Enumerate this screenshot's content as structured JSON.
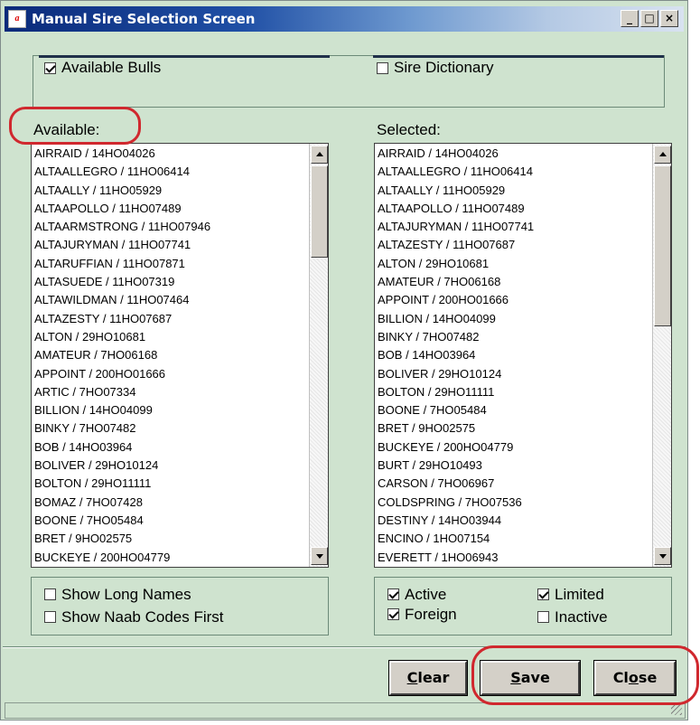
{
  "window": {
    "title": "Manual Sire Selection Screen",
    "min_glyph": "_",
    "max_glyph": "□",
    "close_glyph": "×"
  },
  "source_options": [
    {
      "label": "Available Bulls",
      "checked": true
    },
    {
      "label": "Sire Dictionary",
      "checked": false
    }
  ],
  "available": {
    "heading": "Available:",
    "items": [
      "AIRRAID / 14HO04026",
      "ALTAALLEGRO / 11HO06414",
      "ALTAALLY / 11HO05929",
      "ALTAAPOLLO / 11HO07489",
      "ALTAARMSTRONG / 11HO07946",
      "ALTAJURYMAN / 11HO07741",
      "ALTARUFFIAN / 11HO07871",
      "ALTASUEDE / 11HO07319",
      "ALTAWILDMAN / 11HO07464",
      "ALTAZESTY / 11HO07687",
      "ALTON / 29HO10681",
      "AMATEUR / 7HO06168",
      "APPOINT / 200HO01666",
      "ARTIC / 7HO07334",
      "BILLION / 14HO04099",
      "BINKY / 7HO07482",
      "BOB / 14HO03964",
      "BOLIVER / 29HO10124",
      "BOLTON / 29HO11111",
      "BOMAZ / 7HO07428",
      "BOONE / 7HO05484",
      "BRET / 9HO02575",
      "BUCKEYE / 200HO04779"
    ]
  },
  "selected": {
    "heading": "Selected:",
    "items": [
      "AIRRAID / 14HO04026",
      "ALTAALLEGRO / 11HO06414",
      "ALTAALLY / 11HO05929",
      "ALTAAPOLLO / 11HO07489",
      "ALTAJURYMAN / 11HO07741",
      "ALTAZESTY / 11HO07687",
      "ALTON / 29HO10681",
      "AMATEUR / 7HO06168",
      "APPOINT / 200HO01666",
      "BILLION / 14HO04099",
      "BINKY / 7HO07482",
      "BOB / 14HO03964",
      "BOLIVER / 29HO10124",
      "BOLTON / 29HO11111",
      "BOONE / 7HO05484",
      "BRET / 9HO02575",
      "BUCKEYE / 200HO04779",
      "BURT / 29HO10493",
      "CARSON / 7HO06967",
      "COLDSPRING / 7HO07536",
      "DESTINY / 14HO03944",
      "ENCINO / 1HO07154",
      "EVERETT / 1HO06943"
    ]
  },
  "display_options": {
    "show_long_names": {
      "label": "Show Long Names",
      "checked": false
    },
    "show_naab_first": {
      "label": "Show Naab Codes First",
      "checked": false
    }
  },
  "status_filters": {
    "active": {
      "label": "Active",
      "checked": true
    },
    "limited": {
      "label": "Limited",
      "checked": true
    },
    "foreign": {
      "label": "Foreign",
      "checked": true
    },
    "inactive": {
      "label": "Inactive",
      "checked": false
    }
  },
  "buttons": {
    "clear": {
      "mnemonic": "C",
      "rest": "lear"
    },
    "save": {
      "mnemonic": "S",
      "rest": "ave"
    },
    "close": {
      "pre": "Cl",
      "mnemonic": "o",
      "rest": "se"
    }
  },
  "colors": {
    "window_bg": "#cfe3cf",
    "title_gradient_start": "#0a2a7a",
    "highlight_annotation": "#d0282e"
  }
}
